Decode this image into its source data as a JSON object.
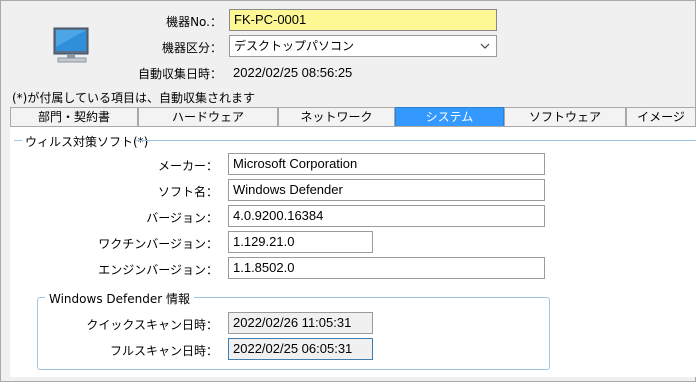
{
  "header": {
    "device_no_label": "機器No.：",
    "device_no_value": "FK-PC-0001",
    "device_type_label": "機器区分：",
    "device_type_value": "デスクトップパソコン",
    "auto_collect_label": "自動収集日時：",
    "auto_collect_value": "2022/02/25 08:56:25",
    "note": "(*)が付属している項目は、自動収集されます",
    "device_icon": "desktop-monitor-icon"
  },
  "tabs": [
    {
      "label": "部門・契約書",
      "active": false
    },
    {
      "label": "ハードウェア",
      "active": false
    },
    {
      "label": "ネットワーク",
      "active": false
    },
    {
      "label": "システム",
      "active": true
    },
    {
      "label": "ソフトウェア",
      "active": false
    },
    {
      "label": "イメージ",
      "active": false
    }
  ],
  "antivirus": {
    "section_title": "ウィルス対策ソフト(*)",
    "maker_label": "メーカー：",
    "maker_value": "Microsoft Corporation",
    "soft_name_label": "ソフト名：",
    "soft_name_value": "Windows Defender",
    "version_label": "バージョン：",
    "version_value": "4.0.9200.16384",
    "vaccine_version_label": "ワクチンバージョン：",
    "vaccine_version_value": "1.129.21.0",
    "engine_version_label": "エンジンバージョン：",
    "engine_version_value": "1.1.8502.0"
  },
  "defender": {
    "group_title": "Windows Defender 情報",
    "quick_scan_label": "クイックスキャン日時：",
    "quick_scan_value": "2022/02/26 11:05:31",
    "full_scan_label": "フルスキャン日時：",
    "full_scan_value": "2022/02/25 06:05:31"
  },
  "colors": {
    "accent": "#3399ff",
    "highlight": "#fdf893",
    "group_border": "#a0c4e4"
  }
}
